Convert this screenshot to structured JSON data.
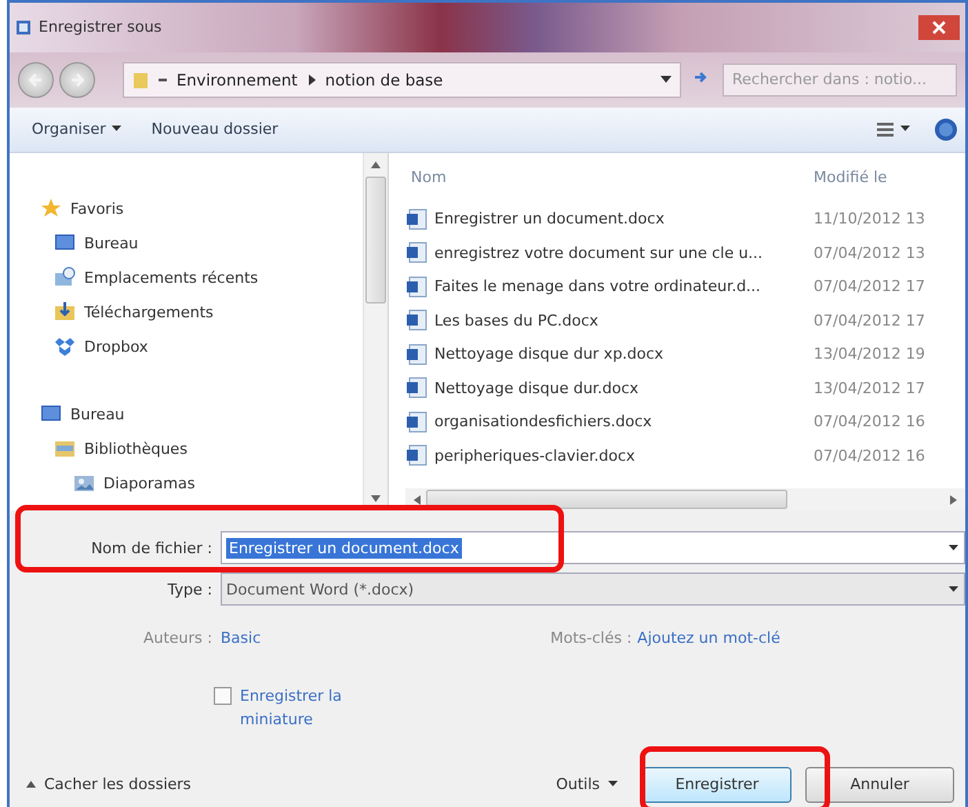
{
  "window": {
    "title": "Enregistrer sous"
  },
  "breadcrumb": [
    "Environnement",
    "notion de base"
  ],
  "search": {
    "placeholder": "Rechercher dans : notio..."
  },
  "toolbar": {
    "organize": "Organiser",
    "new_folder": "Nouveau dossier"
  },
  "nav": [
    {
      "label": "Favoris",
      "kind": "star",
      "children": [
        {
          "label": "Bureau",
          "kind": "desktop"
        },
        {
          "label": "Emplacements récents",
          "kind": "recent"
        },
        {
          "label": "Téléchargements",
          "kind": "download"
        },
        {
          "label": "Dropbox",
          "kind": "dropbox"
        }
      ]
    },
    {
      "label": "Bureau",
      "kind": "desktop",
      "children": [
        {
          "label": "Bibliothèques",
          "kind": "library",
          "children": [
            {
              "label": "Diaporamas",
              "kind": "pictures"
            }
          ]
        }
      ]
    }
  ],
  "table": {
    "columns": [
      "Nom",
      "Modifié le"
    ],
    "rows": [
      {
        "name": "Enregistrer un document.docx",
        "date": "11/10/2012 13"
      },
      {
        "name": "enregistrez votre document sur une cle u...",
        "date": "07/04/2012 13"
      },
      {
        "name": "Faites le menage dans votre ordinateur.d...",
        "date": "07/04/2012 17"
      },
      {
        "name": "Les bases du PC.docx",
        "date": "07/04/2012 17"
      },
      {
        "name": "Nettoyage disque dur xp.docx",
        "date": "13/04/2012 19"
      },
      {
        "name": "Nettoyage disque dur.docx",
        "date": "13/04/2012 17"
      },
      {
        "name": "organisationdesfichiers.docx",
        "date": "07/04/2012 16"
      },
      {
        "name": "peripheriques-clavier.docx",
        "date": "07/04/2012 16"
      }
    ]
  },
  "form": {
    "filename_label": "Nom de fichier :",
    "filename": "Enregistrer un document.docx",
    "type_label": "Type :",
    "type": "Document Word (*.docx)",
    "author_label": "Auteurs :",
    "author": "Basic",
    "tags_label": "Mots-clés :",
    "tags": "Ajoutez un mot-clé",
    "thumbnail": {
      "label": "Enregistrer la miniature",
      "checked": false
    }
  },
  "footer": {
    "hide_folders": "Cacher les dossiers",
    "tools": "Outils",
    "buttons": [
      "Enregistrer",
      "Annuler"
    ]
  }
}
